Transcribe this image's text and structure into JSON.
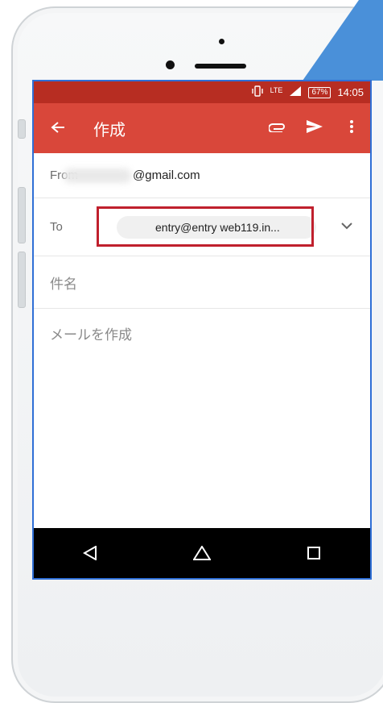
{
  "status_bar": {
    "network": "LTE",
    "battery": "67%",
    "time": "14:05"
  },
  "app_bar": {
    "back_icon": "arrow-left-icon",
    "title": "作成",
    "attach_icon": "paperclip-icon",
    "send_icon": "send-icon",
    "menu_icon": "more-vert-icon"
  },
  "compose": {
    "from_label": "From",
    "from_email": "@gmail.com",
    "to_label": "To",
    "to_chip": "entry@entry    web119.in...",
    "subject_placeholder": "件名",
    "body_placeholder": "メールを作成"
  },
  "nav_bar": {
    "back": "triangle-back-icon",
    "home": "home-icon",
    "recents": "square-recents-icon"
  },
  "colors": {
    "status_bar": "#b72d22",
    "app_bar": "#d9473a",
    "highlight": "#c0202d",
    "screen_border": "#2f6fd6",
    "callout": "#4a90d9"
  }
}
